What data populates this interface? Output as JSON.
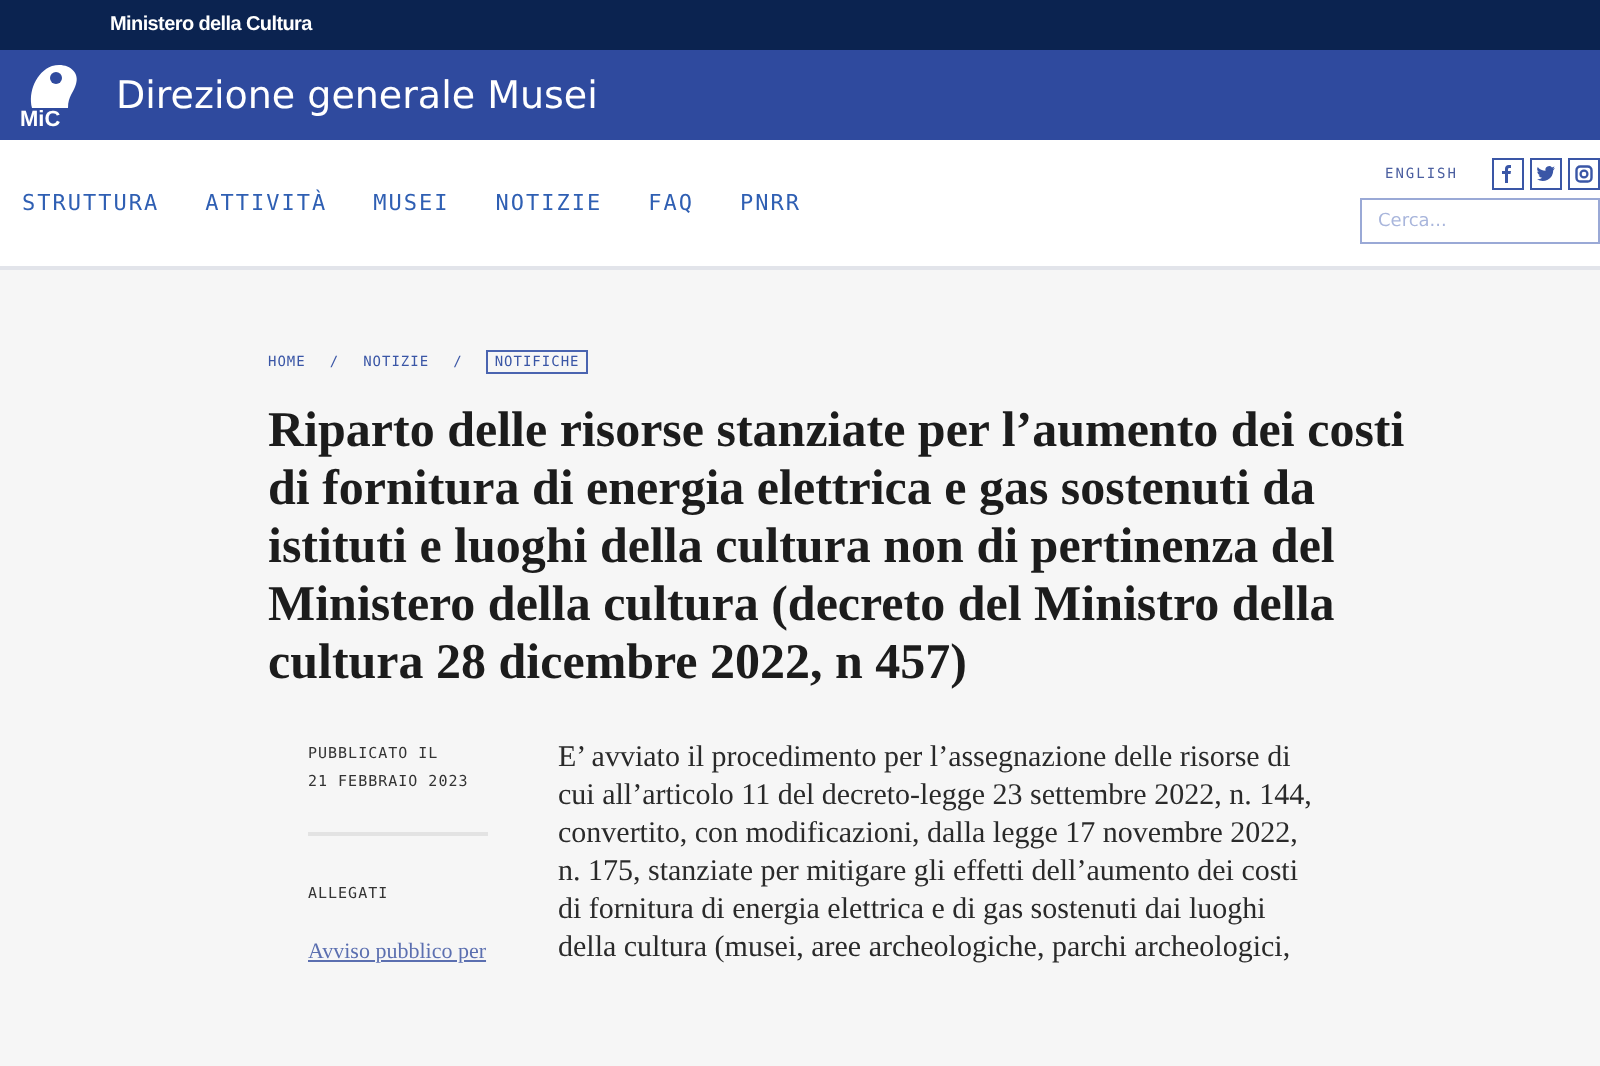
{
  "top_bar": {
    "title": "Ministero della Cultura"
  },
  "header": {
    "logo_text": "MiC",
    "title": "Direzione generale Musei"
  },
  "nav": {
    "items": [
      {
        "label": "STRUTTURA"
      },
      {
        "label": "ATTIVITÀ"
      },
      {
        "label": "MUSEI"
      },
      {
        "label": "NOTIZIE"
      },
      {
        "label": "FAQ"
      },
      {
        "label": "PNRR"
      }
    ],
    "language": "ENGLISH",
    "social": [
      {
        "kind": "facebook"
      },
      {
        "kind": "twitter"
      },
      {
        "kind": "instagram"
      }
    ],
    "search": {
      "placeholder": "Cerca..."
    }
  },
  "breadcrumb_separator": "/",
  "breadcrumb": [
    {
      "label": "HOME",
      "selected": false
    },
    {
      "label": "NOTIZIE",
      "selected": false
    },
    {
      "label": "NOTIFICHE",
      "selected": true
    }
  ],
  "article": {
    "title": "Riparto delle risorse stanziate per l’aumento dei costi di fornitura di energia elettrica e gas sostenuti da istituti e luoghi della cultura non di pertinenza del Ministero della cultura (decreto del Ministro della cultura 28 dicembre 2022, n 457)",
    "published_label": "PUBBLICATO IL",
    "published_date": "21 FEBBRAIO 2023",
    "attachments_label": "ALLEGATI",
    "attachment_link": "Avviso pubblico per",
    "body": "E’ avviato il procedimento per l’assegnazione delle risorse di cui all’articolo 11 del decreto-legge 23 settembre 2022, n. 144, convertito, con modificazioni, dalla legge 17 novembre 2022, n. 175, stanziate per mitigare gli effetti dell’aumento dei costi di fornitura di energia elettrica e di gas sostenuti dai luoghi della cultura (musei, aree archeologiche, parchi archeologici,"
  }
}
